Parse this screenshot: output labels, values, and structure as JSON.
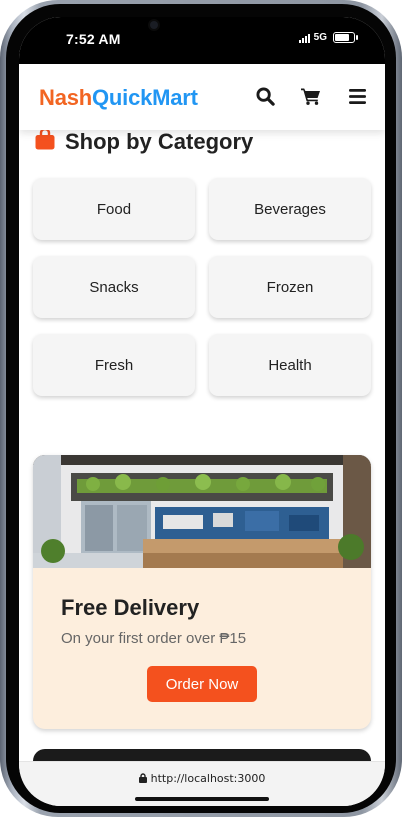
{
  "status_bar": {
    "time": "7:52 AM",
    "network": "5G"
  },
  "header": {
    "brand_part1": "Nash",
    "brand_part2": "QuickMart",
    "brand_colors": {
      "part1": "#f26522",
      "part2": "#2196f3"
    },
    "icons": [
      "search-icon",
      "cart-icon",
      "menu-icon"
    ]
  },
  "categories": {
    "title": "Shop by Category",
    "title_icon": "shopping-bag-icon",
    "items": [
      {
        "label": "Food"
      },
      {
        "label": "Beverages"
      },
      {
        "label": "Snacks"
      },
      {
        "label": "Frozen"
      },
      {
        "label": "Fresh"
      },
      {
        "label": "Health"
      }
    ]
  },
  "promo": {
    "title": "Free Delivery",
    "subtitle": "On your first order over ₱15",
    "button_label": "Order Now",
    "button_color": "#f4511e",
    "background_color": "#fdeedd"
  },
  "browser": {
    "url": "http://localhost:3000"
  }
}
